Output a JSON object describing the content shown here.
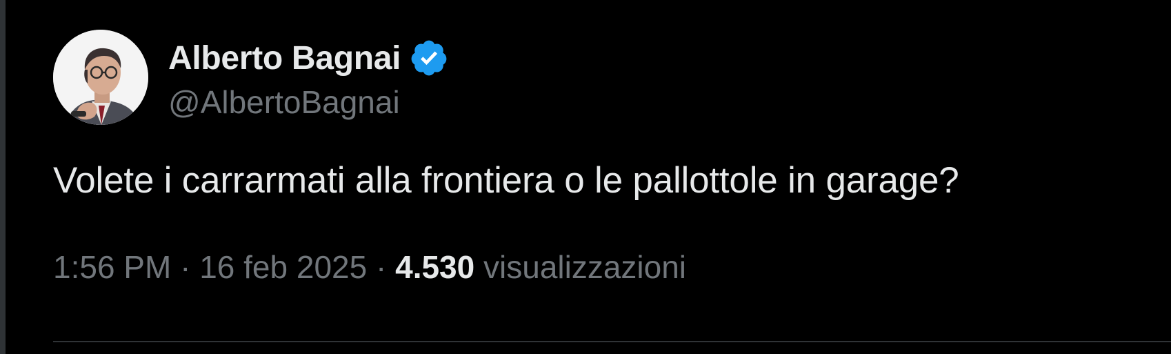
{
  "author": {
    "display_name": "Alberto Bagnai",
    "handle": "@AlbertoBagnai",
    "verified": true,
    "verified_color": "#1d9bf0"
  },
  "tweet": {
    "text": "Volete i carrarmati alla frontiera o le pallottole in garage?"
  },
  "meta": {
    "time": "1:56 PM",
    "dot": "·",
    "date": "16 feb 2025",
    "views_count": "4.530",
    "views_label": "visualizzazioni"
  },
  "colors": {
    "background": "#000000",
    "primary_text": "#e7e9ea",
    "secondary_text": "#71767b",
    "divider": "#2f3336"
  }
}
